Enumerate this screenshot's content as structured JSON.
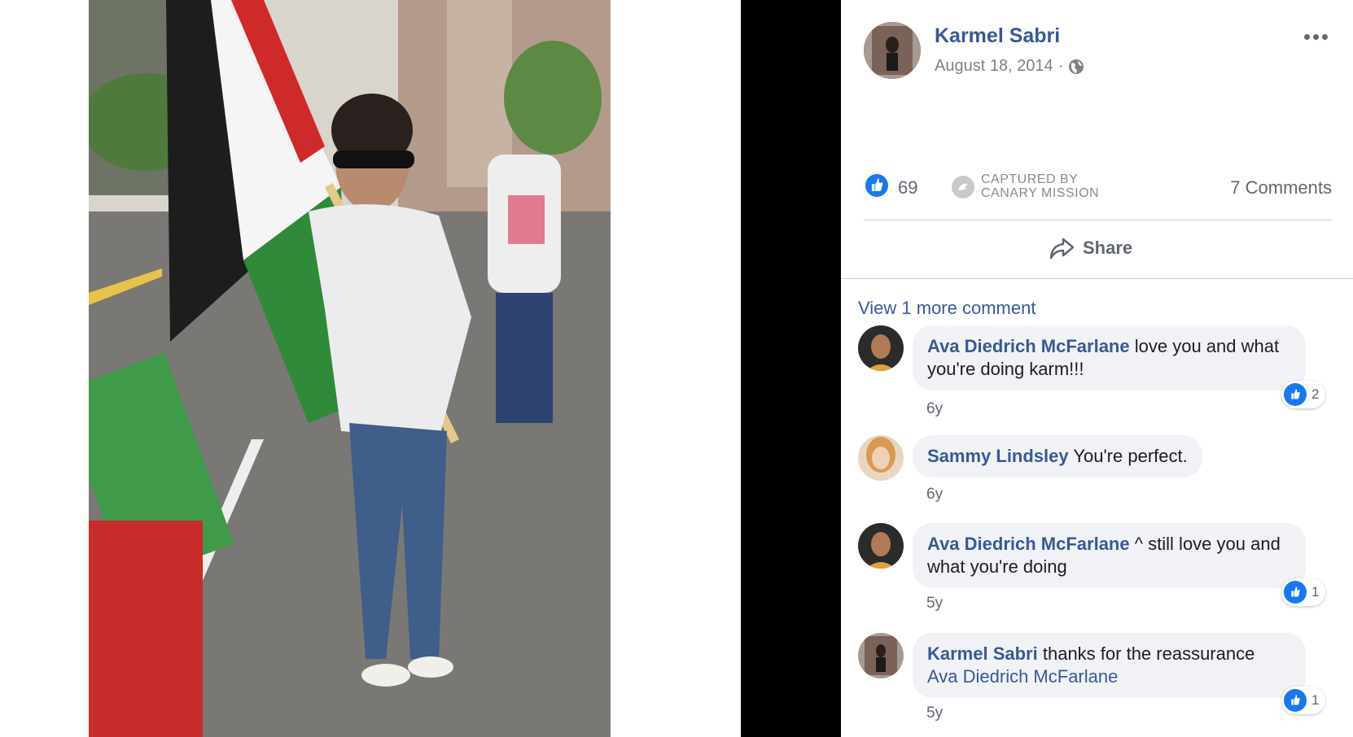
{
  "post": {
    "author": "Karmel Sabri",
    "date": "August 18, 2014",
    "separator": "·",
    "privacy_icon": "globe-icon",
    "more_icon": "more-dots-icon"
  },
  "stats": {
    "like_count": "69",
    "captured_line1": "CAPTURED BY",
    "captured_line2": "CANARY MISSION",
    "comments_count": "7 Comments"
  },
  "actions": {
    "share_label": "Share"
  },
  "comments_section": {
    "view_more": "View 1 more comment",
    "items": [
      {
        "author": "Ava Diedrich McFarlane",
        "text": "love you and what you're doing karm!!!",
        "time": "6y",
        "likes": "2"
      },
      {
        "author": "Sammy Lindsley",
        "text": "You're perfect.",
        "time": "6y",
        "likes": ""
      },
      {
        "author": "Ava Diedrich McFarlane",
        "text": "^ still love you and what you're doing",
        "time": "5y",
        "likes": "1"
      },
      {
        "author": "Karmel Sabri",
        "text": "thanks for the reassurance",
        "mention": "Ava Diedrich McFarlane",
        "time": "5y",
        "likes": "1"
      }
    ]
  },
  "colors": {
    "link_blue": "#385898",
    "like_blue": "#1877f2",
    "bubble_gray": "#f0f2f5",
    "meta_gray": "#606770"
  }
}
